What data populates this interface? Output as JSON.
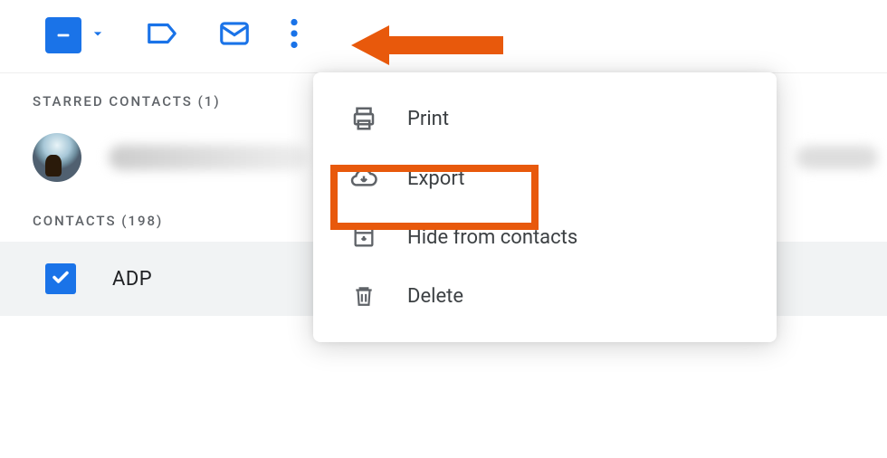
{
  "toolbar": {},
  "sections": {
    "starred_header": "STARRED CONTACTS (1)",
    "contacts_header": "CONTACTS (198)"
  },
  "contacts": {
    "selected_name": "ADP"
  },
  "menu": {
    "print": "Print",
    "export": "Export",
    "hide": "Hide from contacts",
    "delete": "Delete"
  }
}
